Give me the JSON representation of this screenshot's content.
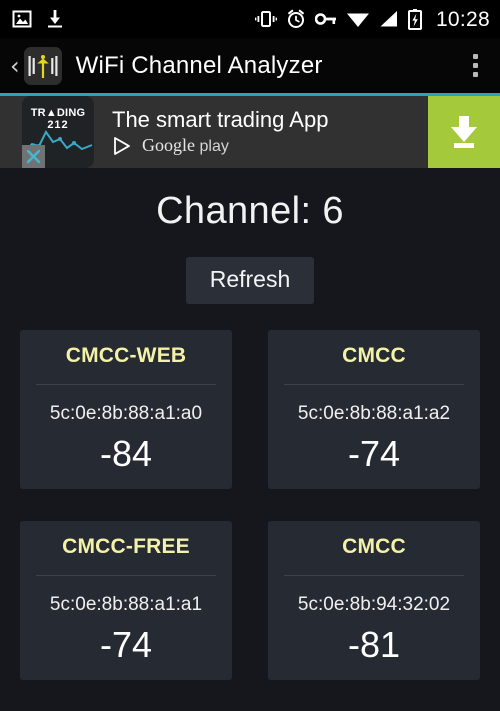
{
  "status_bar": {
    "left_icons": [
      "image-icon",
      "download-icon"
    ],
    "right_icons": [
      "vibrate-icon",
      "alarm-clock-icon",
      "vpn-key-icon",
      "wifi-icon",
      "cellular-signal-icon",
      "battery-charging-icon"
    ],
    "clock": "10:28"
  },
  "action_bar": {
    "back_label": "‹",
    "app_icon": "wifi-analyzer-app-icon",
    "title": "WiFi Channel Analyzer",
    "overflow_icon": "overflow-menu-icon"
  },
  "ad": {
    "logo_line1": "TR▲DING",
    "logo_line2": "212",
    "headline": "The smart trading App",
    "store_name": "Google",
    "store_suffix": "play",
    "cta_icon": "download-icon",
    "close_icon": "close-icon",
    "cta_color": "#a4c93a",
    "accent_color": "#2e9fc7"
  },
  "main": {
    "channel_heading": "Channel: 6",
    "refresh_label": "Refresh",
    "ssid_color": "#f4f2a6",
    "networks": [
      {
        "ssid": "CMCC-WEB",
        "mac": "5c:0e:8b:88:a1:a0",
        "level": "-84"
      },
      {
        "ssid": "CMCC",
        "mac": "5c:0e:8b:88:a1:a2",
        "level": "-74"
      },
      {
        "ssid": "CMCC-FREE",
        "mac": "5c:0e:8b:88:a1:a1",
        "level": "-74"
      },
      {
        "ssid": "CMCC",
        "mac": "5c:0e:8b:94:32:02",
        "level": "-81"
      }
    ]
  }
}
